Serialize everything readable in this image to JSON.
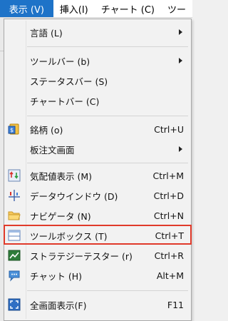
{
  "menubar": {
    "items": [
      {
        "label": "表示 (V)",
        "active": true
      },
      {
        "label": "挿入(I)",
        "active": false
      },
      {
        "label": "チャート (C)",
        "active": false
      },
      {
        "label": "ツー",
        "active": false
      }
    ]
  },
  "menu": {
    "language": {
      "label": "言語 (L)",
      "submenu": true
    },
    "toolbar": {
      "label": "ツールバー (b)",
      "submenu": true
    },
    "statusbar": {
      "label": "ステータスバー (S)"
    },
    "chartbar": {
      "label": "チャートバー (C)"
    },
    "symbols": {
      "label": "銘柄 (o)",
      "shortcut": "Ctrl+U",
      "icon": "symbols-icon"
    },
    "depth": {
      "label": "板注文画面",
      "submenu": true
    },
    "market_watch": {
      "label": "気配値表示 (M)",
      "shortcut": "Ctrl+M",
      "icon": "market-watch-icon"
    },
    "data_window": {
      "label": "データウインドウ (D)",
      "shortcut": "Ctrl+D",
      "icon": "data-window-icon"
    },
    "navigator": {
      "label": "ナビゲータ (N)",
      "shortcut": "Ctrl+N",
      "icon": "folder-icon"
    },
    "toolbox": {
      "label": "ツールボックス (T)",
      "shortcut": "Ctrl+T",
      "icon": "toolbox-icon",
      "highlighted": true
    },
    "strategy_tester": {
      "label": "ストラテジーテスター (r)",
      "shortcut": "Ctrl+R",
      "icon": "strategy-tester-icon"
    },
    "chat": {
      "label": "チャット (H)",
      "shortcut": "Alt+M",
      "icon": "chat-icon"
    },
    "fullscreen": {
      "label": "全画面表示(F)",
      "shortcut": "F11",
      "icon": "fullscreen-icon"
    }
  },
  "colors": {
    "accent": "#1e73c8",
    "highlight_border": "#e03a2a",
    "menu_bg": "#f2f2f2"
  }
}
